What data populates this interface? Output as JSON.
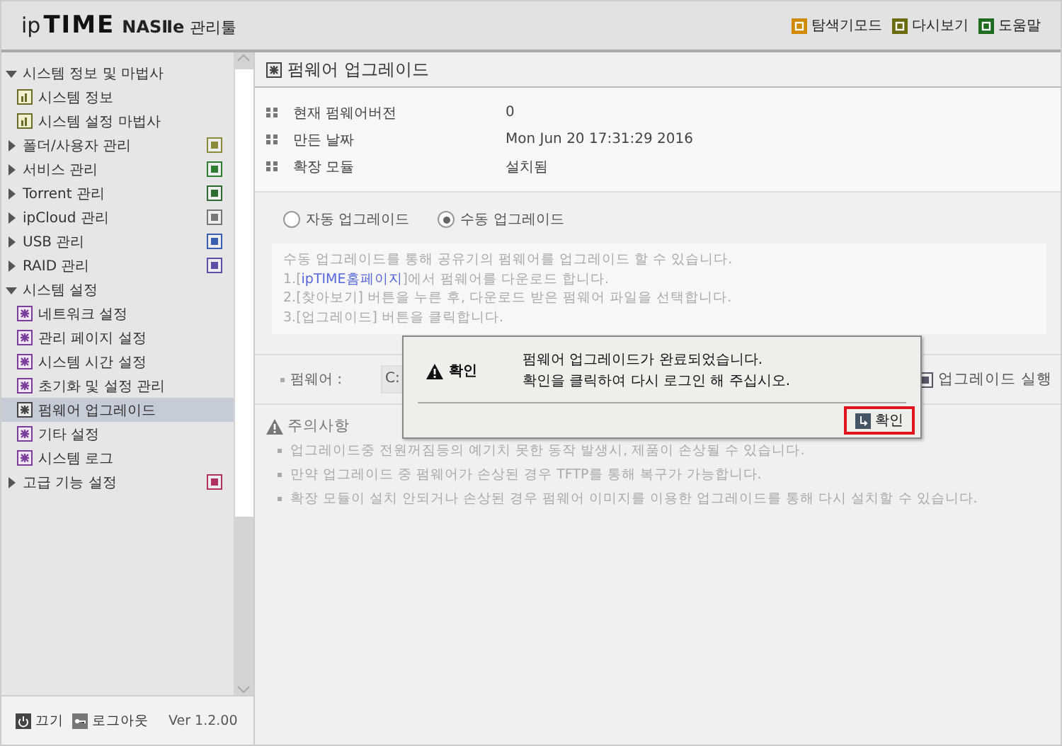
{
  "header": {
    "logo": {
      "prefix": "ip",
      "brand": "TIME",
      "model": "NASⅡe",
      "suffix": "관리툴"
    },
    "links": [
      {
        "label": "탐색기모드",
        "kind": "explorer"
      },
      {
        "label": "다시보기",
        "kind": "refresh"
      },
      {
        "label": "도움말",
        "kind": "help"
      }
    ]
  },
  "sidebar": {
    "items": [
      {
        "label": "시스템 정보 및 마법사",
        "expanded": true,
        "children": [
          {
            "label": "시스템 정보",
            "kind": "info",
            "selected": false
          },
          {
            "label": "시스템 설정 마법사",
            "kind": "info",
            "selected": false
          }
        ]
      },
      {
        "label": "폴더/사용자 관리",
        "expanded": false,
        "color": "#8a8a3a"
      },
      {
        "label": "서비스 관리",
        "expanded": false,
        "color": "#2e7d32"
      },
      {
        "label": "Torrent 관리",
        "expanded": false,
        "color": "#2e6b2e"
      },
      {
        "label": "ipCloud 관리",
        "expanded": false,
        "color": "#777777"
      },
      {
        "label": "USB 관리",
        "expanded": false,
        "color": "#3a5fb0"
      },
      {
        "label": "RAID 관리",
        "expanded": false,
        "color": "#5b4fa8"
      },
      {
        "label": "시스템 설정",
        "expanded": true,
        "children": [
          {
            "label": "네트워크 설정",
            "kind": "setting",
            "selected": false
          },
          {
            "label": "관리 페이지 설정",
            "kind": "setting",
            "selected": false
          },
          {
            "label": "시스템 시간 설정",
            "kind": "setting",
            "selected": false
          },
          {
            "label": "초기화 및 설정 관리",
            "kind": "setting",
            "selected": false
          },
          {
            "label": "펌웨어 업그레이드",
            "kind": "setting",
            "selected": true
          },
          {
            "label": "기타 설정",
            "kind": "setting",
            "selected": false
          },
          {
            "label": "시스템 로그",
            "kind": "setting",
            "selected": false
          }
        ]
      },
      {
        "label": "고급 기능 설정",
        "expanded": false,
        "color": "#b03060"
      }
    ],
    "footer": {
      "power": "끄기",
      "logout": "로그아웃",
      "version": "Ver 1.2.00"
    }
  },
  "main": {
    "title": "펌웨어 업그레이드",
    "info": [
      {
        "label": "현재 펌웨어버전",
        "value": "0"
      },
      {
        "label": "만든 날짜",
        "value": "Mon Jun 20 17:31:29 2016"
      },
      {
        "label": "확장 모듈",
        "value": "설치됨"
      }
    ],
    "modes": [
      {
        "label": "자동 업그레이드",
        "selected": false
      },
      {
        "label": "수동 업그레이드",
        "selected": true
      }
    ],
    "help": [
      {
        "text": "수동 업그레이드를 통해 공유기의 펌웨어를 업그레이드 할 수 있습니다."
      },
      {
        "before": "1.[",
        "link": "ipTIME홈페이지",
        "after": "]에서 펌웨어를 다운로드 합니다."
      },
      {
        "text": "2.[찾아보기] 버튼을 누른 후, 다운로드 받은 펌웨어 파일을 선택합니다."
      },
      {
        "text": "3.[업그레이드] 버튼을 클릭합니다."
      }
    ],
    "firmware": {
      "label": "펌웨어 :",
      "value": "C:"
    },
    "upgrade_button": "업그레이드 실행",
    "caution": {
      "title": "주의사항",
      "items": [
        "업그레이드중 전원꺼짐등의 예기치 못한 동작 발생시, 제품이 손상될 수 있습니다.",
        "만약 업그레이드 중 펌웨어가 손상된 경우 TFTP를 통해 복구가 가능합니다.",
        "확장 모듈이 설치 안되거나 손상된 경우 펌웨어 이미지를 이용한 업그레이드를 통해 다시 설치할 수 있습니다."
      ]
    }
  },
  "dialog": {
    "title": "확인",
    "message": [
      "펌웨어 업그레이드가 완료되었습니다.",
      "확인을 클릭하여 다시 로그인 해 주십시오."
    ],
    "button": "확인"
  }
}
